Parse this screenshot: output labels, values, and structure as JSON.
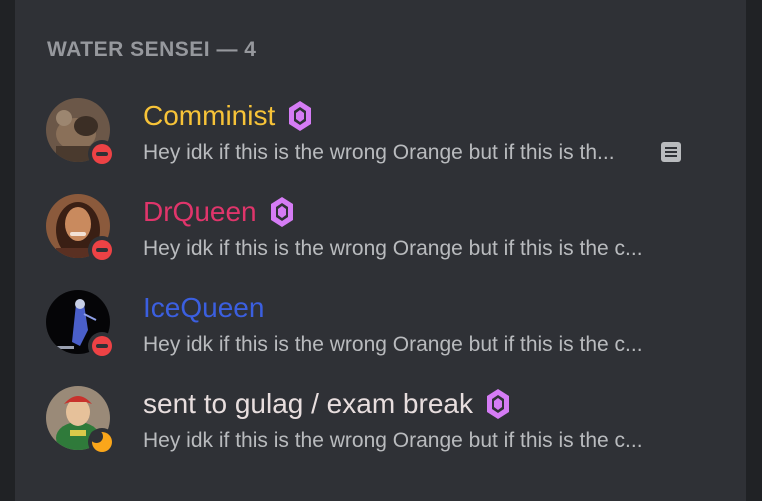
{
  "group": {
    "header": "WATER SENSEI — 4"
  },
  "members": [
    {
      "name": "Comminist",
      "name_color": "#f7c338",
      "status": "dnd",
      "boost_icon": "boost-gem-icon",
      "activity": "Hey idk if this is the wrong Orange but if this is th...",
      "activity_icon": "rich-presence-icon"
    },
    {
      "name": "DrQueen",
      "name_color": "#e0356b",
      "status": "dnd",
      "boost_icon": "boost-gem-icon",
      "activity": "Hey idk if this is the wrong Orange but if this is the c..."
    },
    {
      "name": "IceQueen",
      "name_color": "#3b5fe0",
      "status": "dnd",
      "activity": "Hey idk if this is the wrong Orange but if this is the c..."
    },
    {
      "name": "sent to gulag / exam break",
      "name_color": "#e8dede",
      "status": "idle",
      "boost_icon": "boost-gem-icon",
      "activity": "Hey idk if this is the wrong Orange but if this is the c..."
    }
  ],
  "colors": {
    "boost": "#d57cf5",
    "panel": "#2f3136",
    "muted_text": "#b9bbbe"
  }
}
